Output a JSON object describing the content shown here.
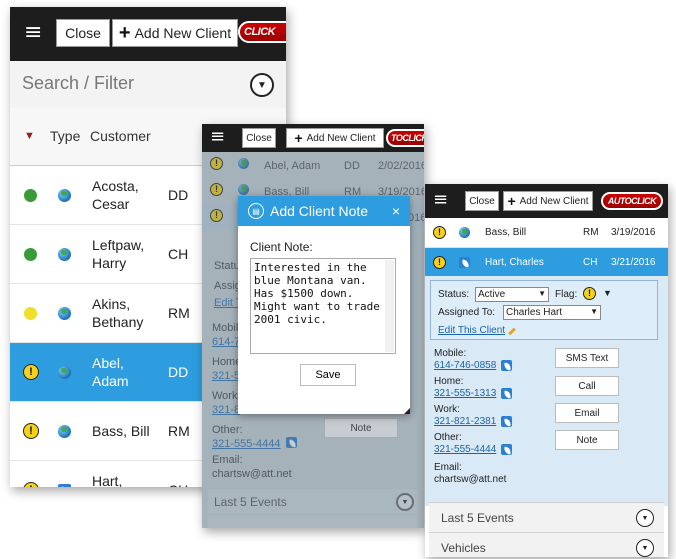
{
  "header": {
    "close_label": "Close",
    "add_label": "Add New Client",
    "logo_text": "AUTOCLICK",
    "logo_text_cropped": "TOCLICK",
    "logo_text_short": "CLICK"
  },
  "client_list": {
    "search_placeholder": "Search / Filter",
    "columns": {
      "type": "Type",
      "customer": "Customer"
    },
    "rows": [
      {
        "customer": "Acosta, Cesar",
        "code": "DD",
        "status": "green",
        "type_icon": "globe-icon"
      },
      {
        "customer": "Leftpaw, Harry",
        "code": "CH",
        "status": "green",
        "type_icon": "globe-icon"
      },
      {
        "customer": "Akins, Bethany",
        "code": "RM",
        "status": "yellow",
        "type_icon": "globe-icon"
      },
      {
        "customer": "Abel, Adam",
        "code": "DD",
        "status": "warning",
        "type_icon": "globe-icon",
        "selected": true
      },
      {
        "customer": "Bass, Bill",
        "code": "RM",
        "status": "warning",
        "type_icon": "globe-icon"
      },
      {
        "customer": "Hart, Charles",
        "code": "CH",
        "status": "warning",
        "type_icon": "phone-icon"
      }
    ]
  },
  "note_view": {
    "rows": [
      {
        "customer": "Abel, Adam",
        "code": "DD",
        "date": "2/02/2016"
      },
      {
        "customer": "Bass, Bill",
        "code": "RM",
        "date": "3/19/2016"
      }
    ],
    "bg_labels": {
      "status": "Statu",
      "assigned": "Assig",
      "edit": "Edit T",
      "mobile": "Mobile",
      "mobile_num": "614-7",
      "home": "Home",
      "home_num": "321-5",
      "work": "Work",
      "work_num": "321-8",
      "other": "Other:",
      "other_num": "321-555-4444",
      "email": "Email:",
      "email_val": "chartsw@att.net",
      "note_btn": "Note",
      "events": "Last 5 Events",
      "code_partial": "016"
    },
    "modal": {
      "title": "Add Client Note",
      "close": "×",
      "label": "Client Note:",
      "text": "Interested in the blue Montana van. Has $1500 down. Might want to trade 2001 civic.",
      "save": "Save"
    }
  },
  "detail_view": {
    "rows": [
      {
        "customer": "Bass, Bill",
        "code": "RM",
        "date": "3/19/2016"
      },
      {
        "customer": "Hart, Charles",
        "code": "CH",
        "date": "3/21/2016",
        "selected": true
      }
    ],
    "status_label": "Status:",
    "status_value": "Active",
    "flag_label": "Flag:",
    "assigned_label": "Assigned To:",
    "assigned_value": "Charles Hart",
    "edit_link": "Edit This Client",
    "contacts": {
      "mobile_label": "Mobile:",
      "mobile": "614-746-0858",
      "home_label": "Home:",
      "home": "321-555-1313",
      "work_label": "Work:",
      "work": "321-821-2381",
      "other_label": "Other:",
      "other": "321-555-4444",
      "email_label": "Email:",
      "email": "chartsw@att.net"
    },
    "actions": {
      "sms": "SMS Text",
      "call": "Call",
      "email": "Email",
      "note": "Note"
    },
    "sections": {
      "events": "Last 5 Events",
      "vehicles": "Vehicles"
    }
  }
}
